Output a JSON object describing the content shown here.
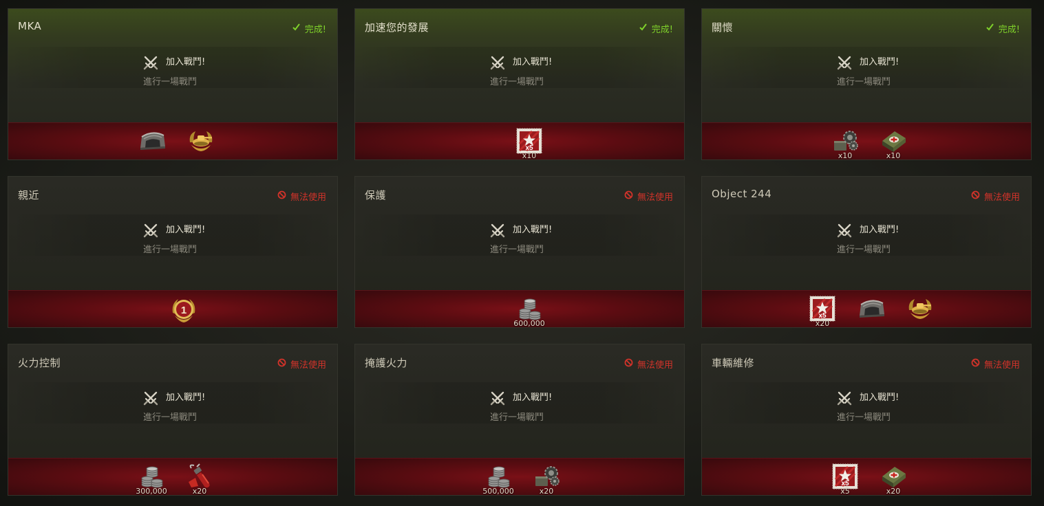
{
  "labels": {
    "task_title": "加入戰鬥!",
    "task_desc": "進行一場戰鬥",
    "status_done": "完成!",
    "status_unavailable": "無法使用"
  },
  "colors": {
    "done_green": "#7fd12a",
    "unavailable_red": "#d2332a",
    "reward_bar": "#6a0e14"
  },
  "cards": [
    {
      "title": "MKA",
      "status": "done",
      "rewards": [
        {
          "icon": "garage-slot-icon",
          "count": ""
        },
        {
          "icon": "tank-emblem-icon",
          "count": ""
        }
      ]
    },
    {
      "title": "加速您的發展",
      "status": "done",
      "rewards": [
        {
          "icon": "x5-xp-stamp-icon",
          "count": "x10"
        }
      ]
    },
    {
      "title": "關懷",
      "status": "done",
      "rewards": [
        {
          "icon": "equipment-kit-icon",
          "count": "x10"
        },
        {
          "icon": "first-aid-kit-icon",
          "count": "x10"
        }
      ]
    },
    {
      "title": "親近",
      "status": "unavailable",
      "rewards": [
        {
          "icon": "rank-1-badge-icon",
          "count": ""
        }
      ]
    },
    {
      "title": "保護",
      "status": "unavailable",
      "rewards": [
        {
          "icon": "credits-stack-icon",
          "count": "600,000"
        }
      ]
    },
    {
      "title": "Object 244",
      "status": "unavailable",
      "rewards": [
        {
          "icon": "x5-xp-stamp-icon",
          "count": "x20"
        },
        {
          "icon": "garage-slot-icon",
          "count": ""
        },
        {
          "icon": "tank-emblem-icon",
          "count": ""
        }
      ]
    },
    {
      "title": "火力控制",
      "status": "unavailable",
      "rewards": [
        {
          "icon": "credits-stack-icon",
          "count": "300,000"
        },
        {
          "icon": "fire-extinguisher-icon",
          "count": "x20"
        }
      ]
    },
    {
      "title": "掩護火力",
      "status": "unavailable",
      "rewards": [
        {
          "icon": "credits-stack-icon",
          "count": "500,000"
        },
        {
          "icon": "equipment-kit-icon",
          "count": "x20"
        }
      ]
    },
    {
      "title": "車輛維修",
      "status": "unavailable",
      "rewards": [
        {
          "icon": "x5-xp-stamp-icon",
          "count": "x5"
        },
        {
          "icon": "first-aid-kit-icon",
          "count": "x20"
        }
      ]
    }
  ],
  "stamp_label": "x5",
  "rank_label": "1"
}
